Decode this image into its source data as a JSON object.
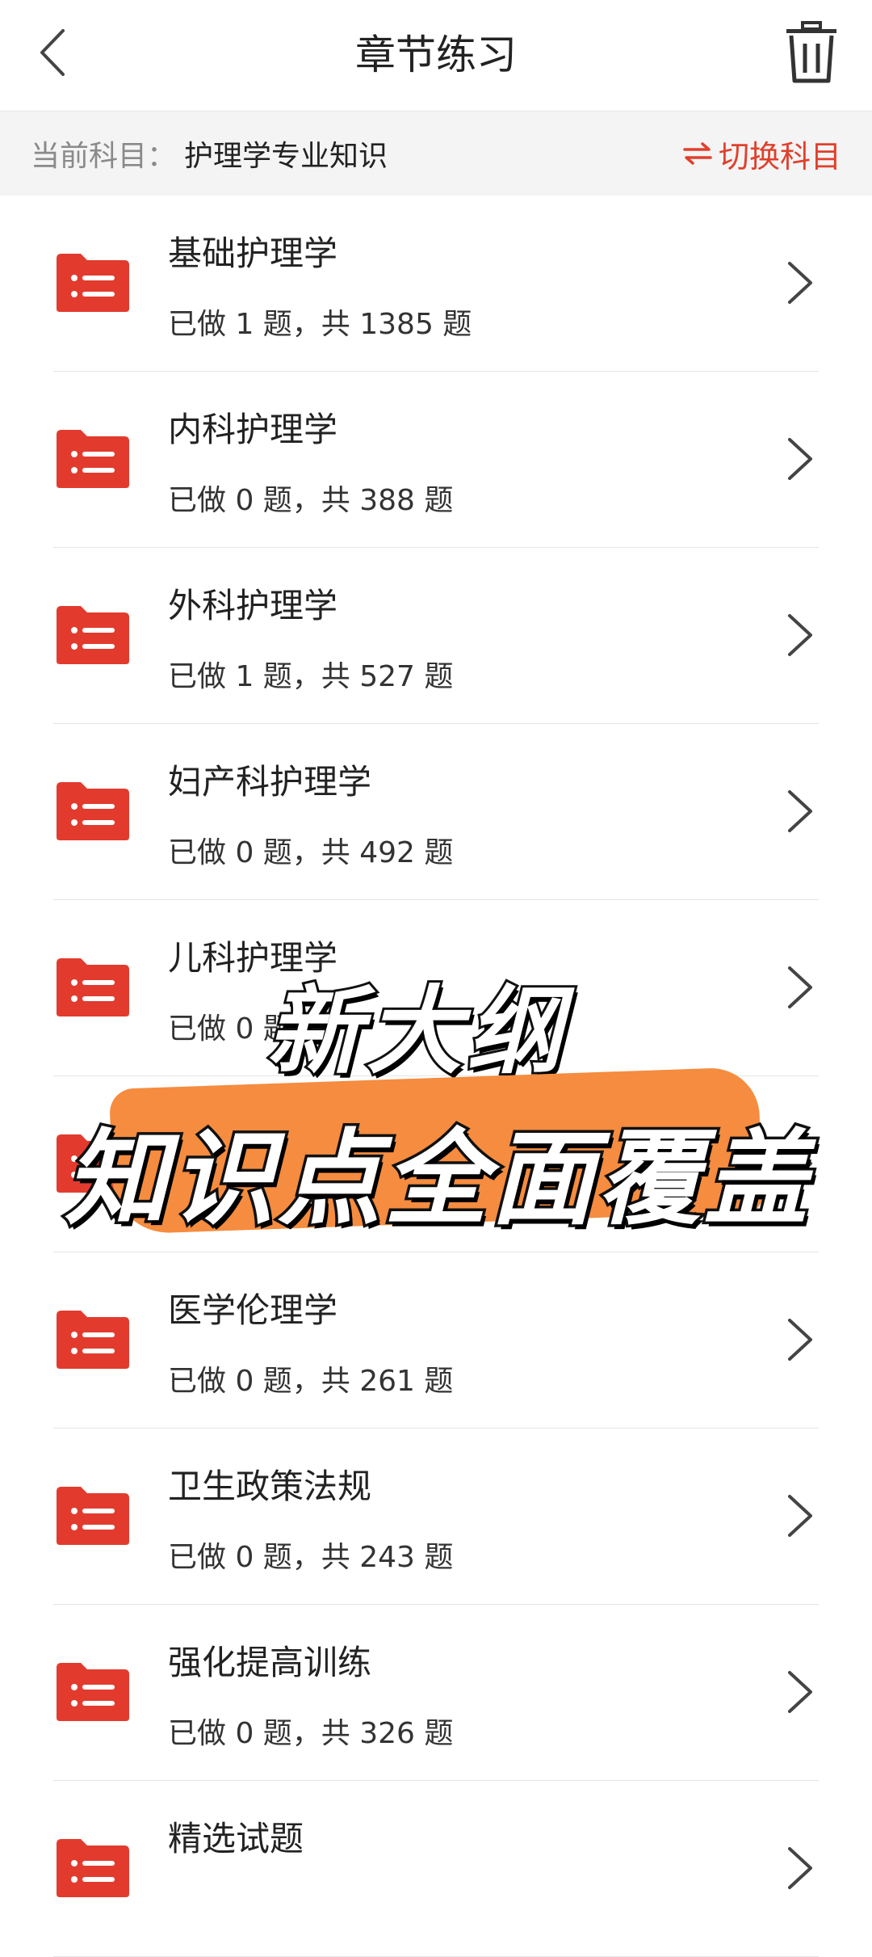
{
  "header": {
    "title": "章节练习"
  },
  "subject": {
    "label": "当前科目：",
    "value": "护理学专业知识",
    "switch_label": "切换科目"
  },
  "colors": {
    "accent": "#e0402c",
    "folder": "#e23b2e",
    "overlay_brush": "#f58c3f"
  },
  "chapters": [
    {
      "name": "基础护理学",
      "stat": "已做 1 题，共 1385 题"
    },
    {
      "name": "内科护理学",
      "stat": "已做 0 题，共 388 题"
    },
    {
      "name": "外科护理学",
      "stat": "已做 1 题，共 527 题"
    },
    {
      "name": "妇产科护理学",
      "stat": "已做 0 题，共 492 题"
    },
    {
      "name": "儿科护理学",
      "stat": "已做 0 题"
    },
    {
      "name": "",
      "stat": ""
    },
    {
      "name": "医学伦理学",
      "stat": "已做 0 题，共 261 题"
    },
    {
      "name": "卫生政策法规",
      "stat": "已做 0 题，共 243 题"
    },
    {
      "name": "强化提高训练",
      "stat": "已做 0 题，共 326 题"
    },
    {
      "name": "精选试题",
      "stat": ""
    }
  ],
  "overlay": {
    "line1": "新大纲",
    "line2": "知识点全面覆盖"
  }
}
